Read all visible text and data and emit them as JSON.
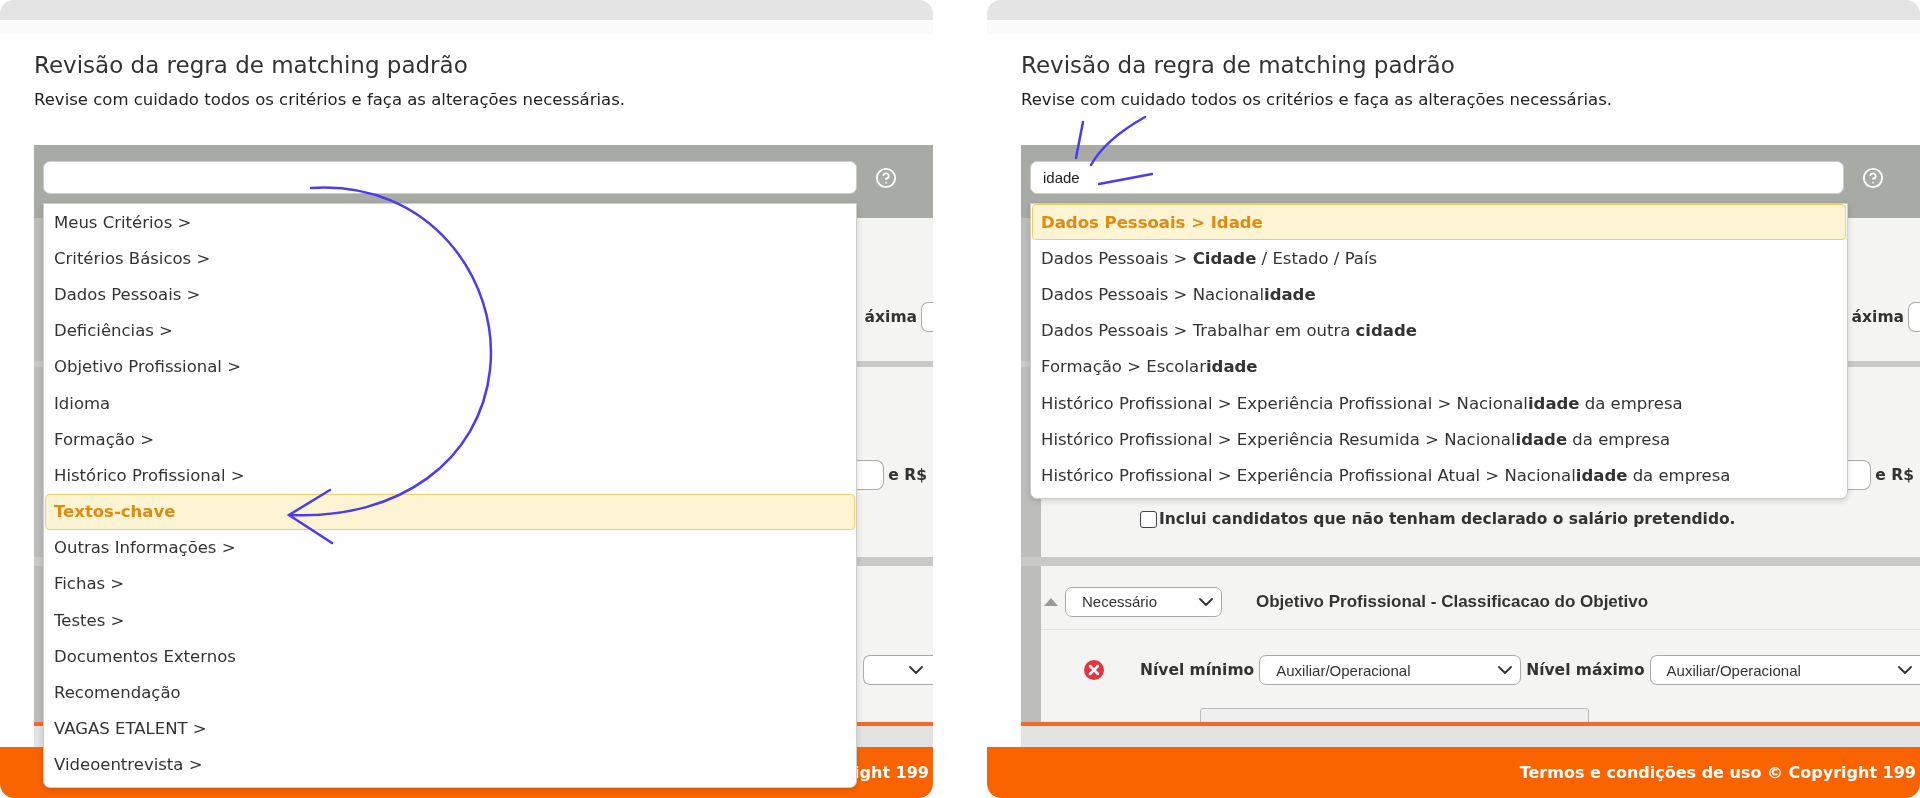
{
  "panels": [
    {
      "title": "Revisão da regra de matching padrão",
      "subtitle": "Revise com cuidado todos os critérios e faça as alterações necessárias.",
      "annotation": {
        "kind": "curved-arrow"
      },
      "dropdown": {
        "items": [
          {
            "label": "Meus Critérios >",
            "selected": false
          },
          {
            "label": "Critérios Básicos >",
            "selected": false
          },
          {
            "label": "Dados Pessoais >",
            "selected": false
          },
          {
            "label": "Deficiências >",
            "selected": false
          },
          {
            "label": "Objetivo Profissional >",
            "selected": false
          },
          {
            "label": "Idioma",
            "selected": false
          },
          {
            "label": "Formação >",
            "selected": false
          },
          {
            "label": "Histórico Profissional >",
            "selected": false
          },
          {
            "label": "Textos-chave",
            "selected": true
          },
          {
            "label": "Outras Informações >",
            "selected": false
          },
          {
            "label": "Fichas >",
            "selected": false
          },
          {
            "label": "Testes >",
            "selected": false
          },
          {
            "label": "Documentos Externos",
            "selected": false
          },
          {
            "label": "Recomendação",
            "selected": false
          },
          {
            "label": "VAGAS ETALENT >",
            "selected": false
          },
          {
            "label": "Videoentrevista >",
            "selected": false
          }
        ]
      },
      "sections": [
        {
          "rows": [
            {
              "kind": "range",
              "label": "áxima"
            }
          ]
        },
        {
          "rows": [
            {
              "kind": "money",
              "label": "e R$"
            }
          ]
        },
        {
          "rows": [
            {
              "kind": "select"
            }
          ]
        }
      ],
      "footer": "ight 199"
    },
    {
      "title": "Revisão da regra de matching padrão",
      "subtitle": "Revise com cuidado todos os critérios e faça as alterações necessárias.",
      "search": {
        "value": "idade"
      },
      "annotation": {
        "kind": "strokes"
      },
      "dropdown": {
        "items": [
          {
            "label": "Dados Pessoais > Idade",
            "selected": true
          },
          {
            "label": "Dados Pessoais > **Cidade** / Estado / País",
            "selected": false
          },
          {
            "label": "Dados Pessoais > Nacional**idade**",
            "selected": false
          },
          {
            "label": "Dados Pessoais > Trabalhar em outra **cidade**",
            "selected": false
          },
          {
            "label": "Formação > Escolar**idade**",
            "selected": false
          },
          {
            "label": "Histórico Profissional > Experiência Profissional > Nacional**idade** da empresa",
            "selected": false
          },
          {
            "label": "Histórico Profissional > Experiência Resumida > Nacional**idade** da empresa",
            "selected": false
          },
          {
            "label": "Histórico Profissional > Experiência Profissional Atual > Nacional**idade** da empresa",
            "selected": false
          }
        ]
      },
      "sections": [
        {
          "rows": [
            {
              "kind": "range",
              "label": "áxima"
            }
          ]
        },
        {
          "rows": [
            {
              "kind": "money",
              "label": "e R$"
            },
            {
              "kind": "checkbox",
              "label": "Inclui candidatos que não tenham declarado o salário pretendido.",
              "checked": false
            }
          ]
        },
        {
          "rows": [
            {
              "kind": "header",
              "select": "Necessário",
              "label": "Objetivo Profissional - Classificacao do Objetivo"
            },
            {
              "kind": "levels",
              "min_label": "Nível mínimo",
              "min_value": "Auxiliar/Operacional",
              "max_label": "Nível máximo",
              "max_value": "Auxiliar/Operacional"
            },
            {
              "kind": "tags"
            }
          ]
        }
      ],
      "footer": "Termos e condições de uso © Copyright 199"
    }
  ]
}
